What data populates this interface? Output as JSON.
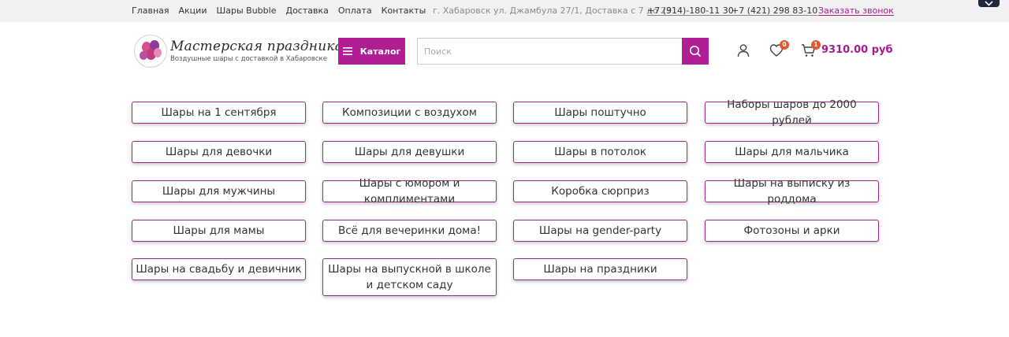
{
  "topbar": {
    "nav": [
      "Главная",
      "Акции",
      "Шары Bubble",
      "Доставка",
      "Оплата",
      "Контакты"
    ],
    "address": "г. Хабаровск ул. Джамбула 27/1, Доставка с 7 до 23",
    "phone1": "+7 (914)-180-11 30",
    "phone2": "+7 (421) 298 83-10",
    "callback": "Заказать звонок"
  },
  "header": {
    "logo_title": "Мастерская праздника",
    "logo_subtitle": "Воздушные шары с доставкой в Хабаровске",
    "catalog_label": "Каталог",
    "search_placeholder": "Поиск",
    "search_value": "",
    "favorites_count": "0",
    "cart_count": "1",
    "cart_total": "9310.00 руб"
  },
  "categories": [
    [
      "Шары на 1 сентября",
      "Композиции с воздухом",
      "Шары поштучно",
      "Наборы шаров до 2000 рублей"
    ],
    [
      "Шары для девочки",
      "Шары для девушки",
      "Шары в потолок",
      "Шары для мальчика"
    ],
    [
      "Шары для мужчины",
      "Шары с юмором и комплиментами",
      "Коробка сюрприз",
      "Шары на выписку из роддома"
    ],
    [
      "Шары для мамы",
      "Всё для вечеринки дома!",
      "Шары на gender-party",
      "Фотозоны и арки"
    ],
    [
      "Шары на свадьбу и девичник",
      "Шары на выпускной в школе и детском саду",
      "Шары на праздники"
    ]
  ],
  "colors": {
    "accent": "#b01e95",
    "accent_text": "#a51c8c",
    "badge": "#e4572e",
    "topbar_bg": "#f1f1f3",
    "category_border": "#9b2a86"
  },
  "icons": [
    "chevron-down-icon",
    "menu-icon",
    "search-icon",
    "user-icon",
    "heart-icon",
    "cart-icon",
    "balloons-logo-icon"
  ]
}
